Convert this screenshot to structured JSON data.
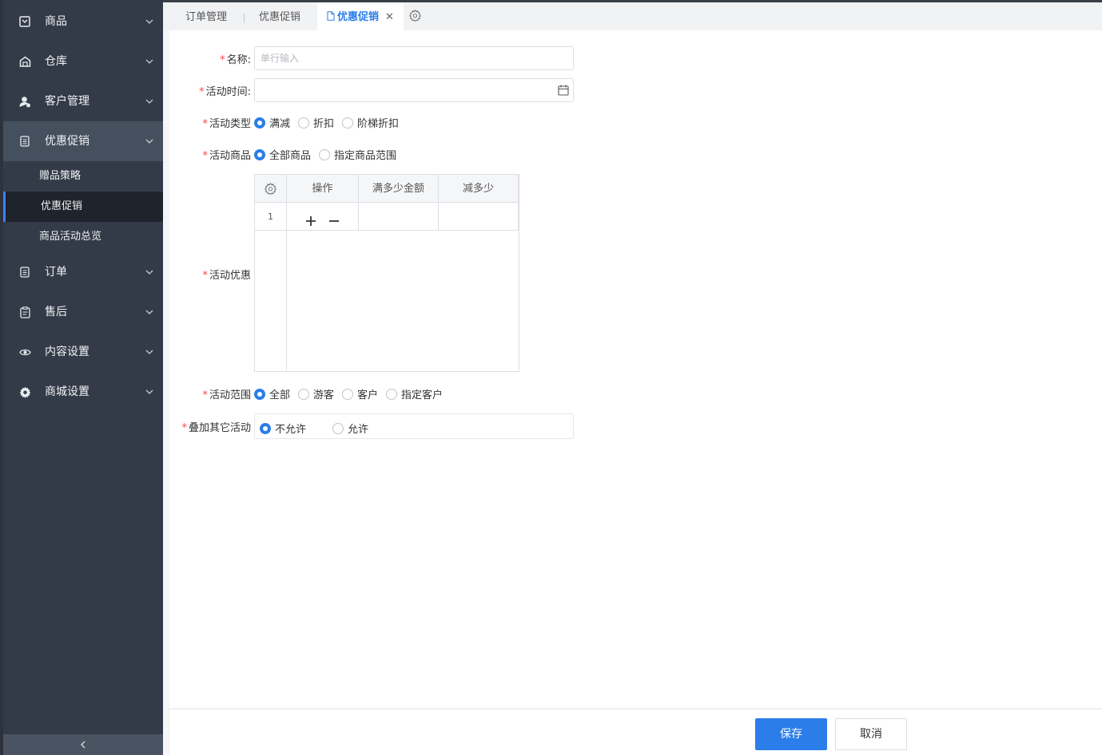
{
  "sidebar": {
    "menus": [
      {
        "label": "商品",
        "icon": "product-icon"
      },
      {
        "label": "仓库",
        "icon": "warehouse-icon"
      },
      {
        "label": "客户管理",
        "icon": "customer-icon"
      },
      {
        "label": "优惠促销",
        "icon": "promotion-icon"
      },
      {
        "label": "订单",
        "icon": "order-icon"
      },
      {
        "label": "售后",
        "icon": "after-sale-icon"
      },
      {
        "label": "内容设置",
        "icon": "eye-icon"
      },
      {
        "label": "商城设置",
        "icon": "gear-icon"
      }
    ],
    "submenu": [
      "赠品策略",
      "优惠促销",
      "商品活动总览"
    ],
    "collapse_icon": "chevron-left-icon"
  },
  "tabs": [
    {
      "label": "订单管理"
    },
    {
      "label": "优惠促销"
    },
    {
      "label": "优惠促销",
      "active": true
    }
  ],
  "form": {
    "name": {
      "label": "名称:",
      "placeholder": "单行输入"
    },
    "time": {
      "label": "活动时间:"
    },
    "type": {
      "label": "活动类型",
      "options": [
        "满减",
        "折扣",
        "阶梯折扣"
      ],
      "selected": "满减"
    },
    "goods": {
      "label": "活动商品",
      "options": [
        "全部商品",
        "指定商品范围"
      ],
      "selected": "全部商品"
    },
    "discount": {
      "label": "活动优惠",
      "columns": [
        "操作",
        "满多少金额",
        "减多少"
      ],
      "rows": [
        {
          "index": "1",
          "threshold": "",
          "reduce": ""
        }
      ]
    },
    "scope": {
      "label": "活动范围",
      "options": [
        "全部",
        "游客",
        "客户",
        "指定客户"
      ],
      "selected": "全部"
    },
    "stack": {
      "label": "叠加其它活动",
      "options": [
        "不允许",
        "允许"
      ],
      "selected": "不允许"
    }
  },
  "footer": {
    "save": "保存",
    "cancel": "取消"
  },
  "colors": {
    "accent": "#2b7de9",
    "sidebar": "#343b48",
    "required": "#ff4444"
  }
}
